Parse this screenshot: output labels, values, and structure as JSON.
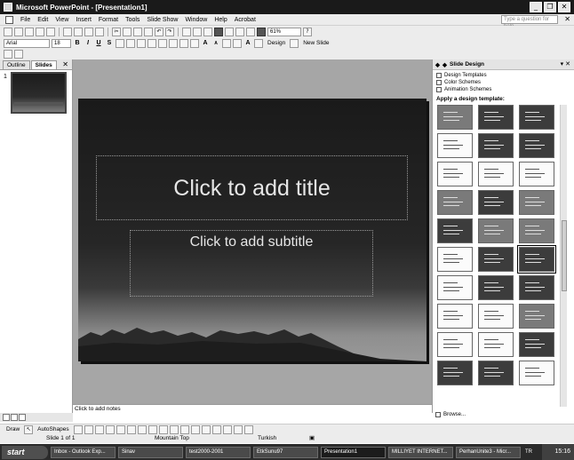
{
  "window": {
    "title": "Microsoft PowerPoint - [Presentation1]"
  },
  "menu": [
    "File",
    "Edit",
    "View",
    "Insert",
    "Format",
    "Tools",
    "Slide Show",
    "Window",
    "Help",
    "Acrobat"
  ],
  "help_search": {
    "placeholder": "Type a question for help"
  },
  "toolbar": {
    "zoom": "61%",
    "font": "Arial",
    "font_size": "18",
    "design_label": "Design",
    "new_slide_label": "New Slide"
  },
  "left_panel": {
    "tab_outline": "Outline",
    "tab_slides": "Slides",
    "slide_number": "1"
  },
  "slide": {
    "title_placeholder": "Click to add title",
    "subtitle_placeholder": "Click to add subtitle"
  },
  "notes": {
    "placeholder": "Click to add notes"
  },
  "task_pane": {
    "title": "Slide Design",
    "links": [
      "Design Templates",
      "Color Schemes",
      "Animation Schemes"
    ],
    "apply_label": "Apply a design template:",
    "browse_label": "Browse..."
  },
  "draw_toolbar": {
    "draw_label": "Draw",
    "autoshapes_label": "AutoShapes"
  },
  "status": {
    "slide": "Slide 1 of 1",
    "design": "Mountain Top",
    "language": "Turkish"
  },
  "taskbar": {
    "start_label": "start",
    "tasks": [
      "Inbox - Outlook Exp...",
      "Sinav",
      "test2000-2001",
      "EtkSunu97",
      "Presentation1",
      "MILLIYET INTERNET...",
      "PerhanUnite3 - Micr..."
    ],
    "tray_lang": "TR",
    "clock": "15:16"
  }
}
